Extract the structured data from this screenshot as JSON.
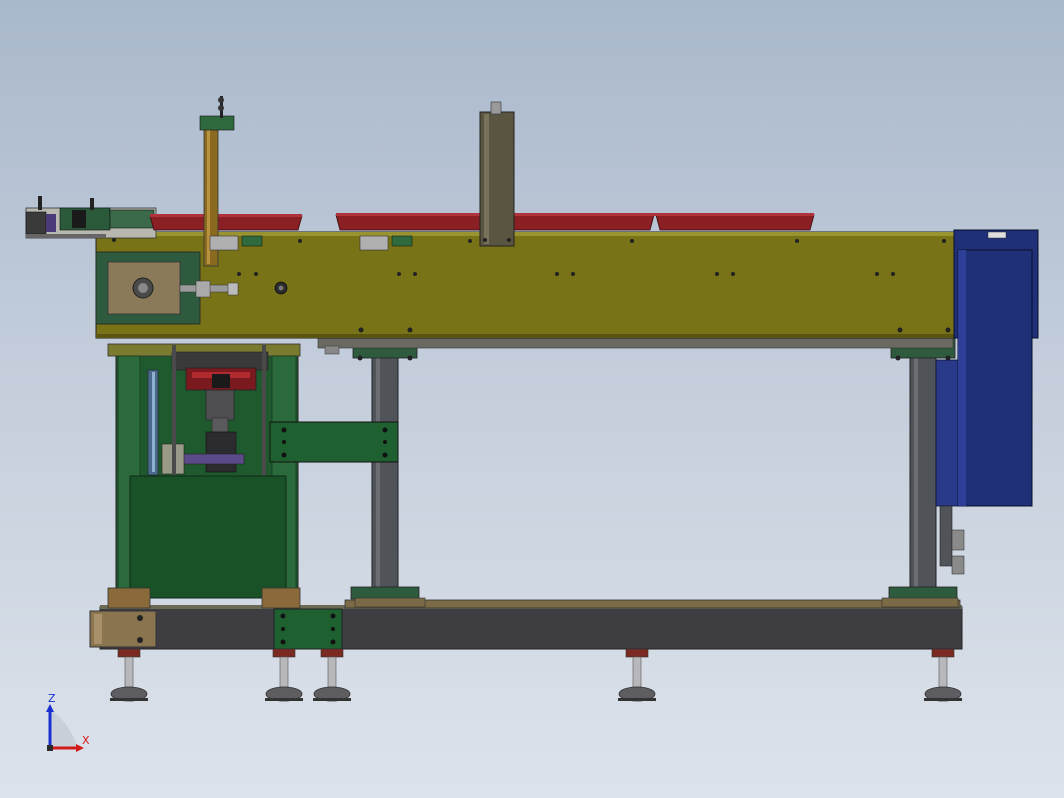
{
  "viewport": {
    "background_top": "#a9b8cb",
    "background_bottom": "#dde3eb"
  },
  "colors": {
    "frame_olive": "#7a7420",
    "frame_olive_light": "#8f8a2a",
    "bracket_green": "#2e5a3e",
    "panel_green": "#1f5a2e",
    "base_dark": "#3c3c40",
    "leg_gray": "#55585e",
    "motor_blue": "#1f2f78",
    "conveyor_red": "#8a1f24",
    "pad_brown": "#8a6a3a",
    "foot_gray": "#6e6e72",
    "cylinder_tan": "#5a5540"
  },
  "model": {
    "description_icon": "machine-assembly-icon"
  },
  "triad": {
    "z_label": "Z",
    "x_label": "X",
    "z_color": "#1a2fd0",
    "x_color": "#d21a1a"
  }
}
